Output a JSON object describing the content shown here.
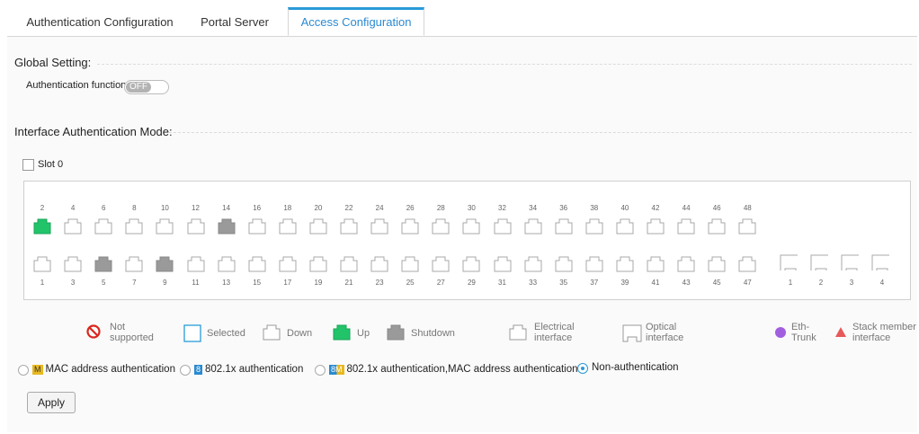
{
  "tabs": [
    {
      "label": "Authentication Configuration",
      "active": false
    },
    {
      "label": "Portal Server",
      "active": false
    },
    {
      "label": "Access Configuration",
      "active": true
    }
  ],
  "global_setting": {
    "title": "Global Setting:",
    "auth_function_label": "Authentication function:",
    "auth_function_state": "OFF"
  },
  "interface_mode": {
    "title": "Interface Authentication Mode:",
    "slot_label": "Slot 0"
  },
  "ports": {
    "top_numbers": [
      "2",
      "4",
      "6",
      "8",
      "10",
      "12",
      "14",
      "16",
      "18",
      "20",
      "22",
      "24",
      "26",
      "28",
      "30",
      "32",
      "34",
      "36",
      "38",
      "40",
      "42",
      "44",
      "46",
      "48"
    ],
    "bottom_numbers": [
      "1",
      "3",
      "5",
      "7",
      "9",
      "11",
      "13",
      "15",
      "17",
      "19",
      "21",
      "23",
      "25",
      "27",
      "29",
      "31",
      "33",
      "35",
      "37",
      "39",
      "41",
      "43",
      "45",
      "47"
    ],
    "optical_numbers": [
      "1",
      "2",
      "3",
      "4"
    ],
    "top_states": [
      "up",
      "down",
      "down",
      "down",
      "down",
      "down",
      "shutdown",
      "down",
      "down",
      "down",
      "down",
      "down",
      "down",
      "down",
      "down",
      "down",
      "down",
      "down",
      "down",
      "down",
      "down",
      "down",
      "down",
      "down"
    ],
    "bottom_states": [
      "down",
      "down",
      "shutdown",
      "down",
      "shutdown",
      "down",
      "down",
      "down",
      "down",
      "down",
      "down",
      "down",
      "down",
      "down",
      "down",
      "down",
      "down",
      "down",
      "down",
      "down",
      "down",
      "down",
      "down",
      "down"
    ]
  },
  "legend": {
    "not_supported": "Not\nsupported",
    "selected": "Selected",
    "down": "Down",
    "up": "Up",
    "shutdown": "Shutdown",
    "electrical": "Electrical\ninterface",
    "optical": "Optical\ninterface",
    "eth_trunk": "Eth-\nTrunk",
    "stack_member": "Stack member\ninterface"
  },
  "auth_modes": [
    {
      "badge": "M",
      "label": "MAC address authentication",
      "checked": false
    },
    {
      "badge": "8",
      "label": "802.1x authentication",
      "checked": false
    },
    {
      "badge": "8M",
      "label": "802.1x authentication,MAC address authentication",
      "checked": false
    },
    {
      "badge": "",
      "label": "Non-authentication",
      "checked": true
    }
  ],
  "apply_label": "Apply",
  "colors": {
    "accent": "#2a9ad8",
    "port_up": "#22c46a",
    "port_shutdown": "#9a9a9a",
    "not_supported": "#d9261c",
    "eth_trunk": "#a15fe0",
    "stack_member": "#e8595a",
    "badge_mac": "#e8b820",
    "badge_8021x": "#2a8ad0"
  }
}
